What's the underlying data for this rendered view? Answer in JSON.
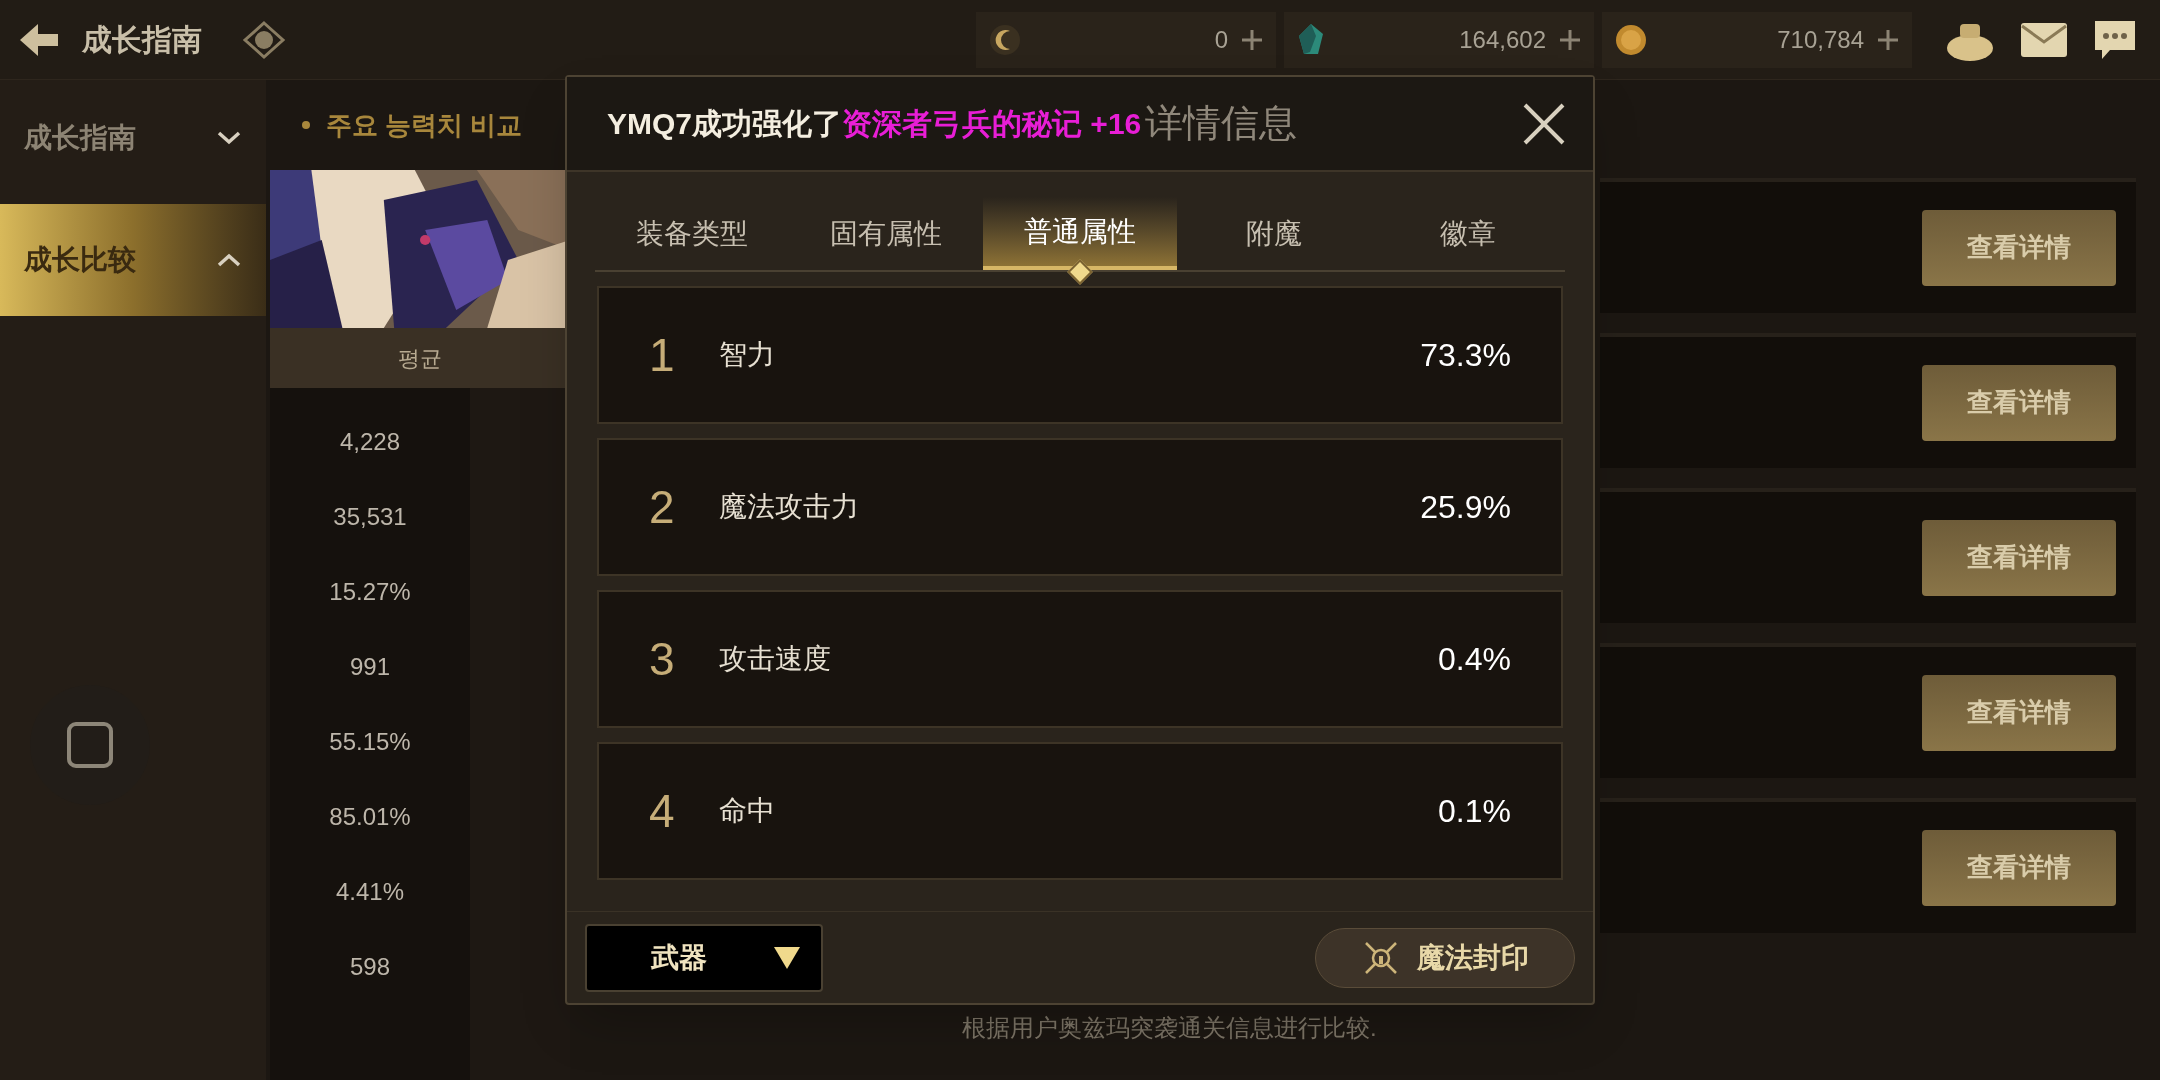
{
  "top_bar": {
    "title": "成长指南",
    "currencies": [
      {
        "kind": "crescent",
        "amount": "0"
      },
      {
        "kind": "gem",
        "amount": "164,602"
      },
      {
        "kind": "coin",
        "amount": "710,784"
      }
    ]
  },
  "sidebar": {
    "items": [
      {
        "label": "成长指南",
        "selected": false,
        "expanded": false
      },
      {
        "label": "成长比较",
        "selected": true,
        "expanded": true
      }
    ]
  },
  "comparison": {
    "heading": "주요 능력치 비교",
    "column_header": "평균",
    "values": [
      "4,228",
      "35,531",
      "15.27%",
      "991",
      "55.15%",
      "85.01%",
      "4.41%",
      "598"
    ],
    "row_buttons": [
      "查看详情",
      "查看详情",
      "查看详情",
      "查看详情",
      "查看详情"
    ],
    "footnote": "根据用户奥兹玛突袭通关信息进行比较."
  },
  "dialog": {
    "notification": {
      "player_text": "YMQ7成功强化了",
      "item_text": "资深者弓兵的秘记 +16"
    },
    "title": "详情信息",
    "tabs": [
      {
        "label": "装备类型",
        "selected": false
      },
      {
        "label": "固有属性",
        "selected": false
      },
      {
        "label": "普通属性",
        "selected": true
      },
      {
        "label": "附魔",
        "selected": false
      },
      {
        "label": "徽章",
        "selected": false
      }
    ],
    "stats": [
      {
        "rank": "1",
        "name": "智力",
        "value": "73.3%"
      },
      {
        "rank": "2",
        "name": "魔法攻击力",
        "value": "25.9%"
      },
      {
        "rank": "3",
        "name": "攻击速度",
        "value": "0.4%"
      },
      {
        "rank": "4",
        "name": "命中",
        "value": "0.1%"
      }
    ],
    "equipment_select": {
      "value": "武器"
    },
    "seal_button": "魔法封印"
  }
}
